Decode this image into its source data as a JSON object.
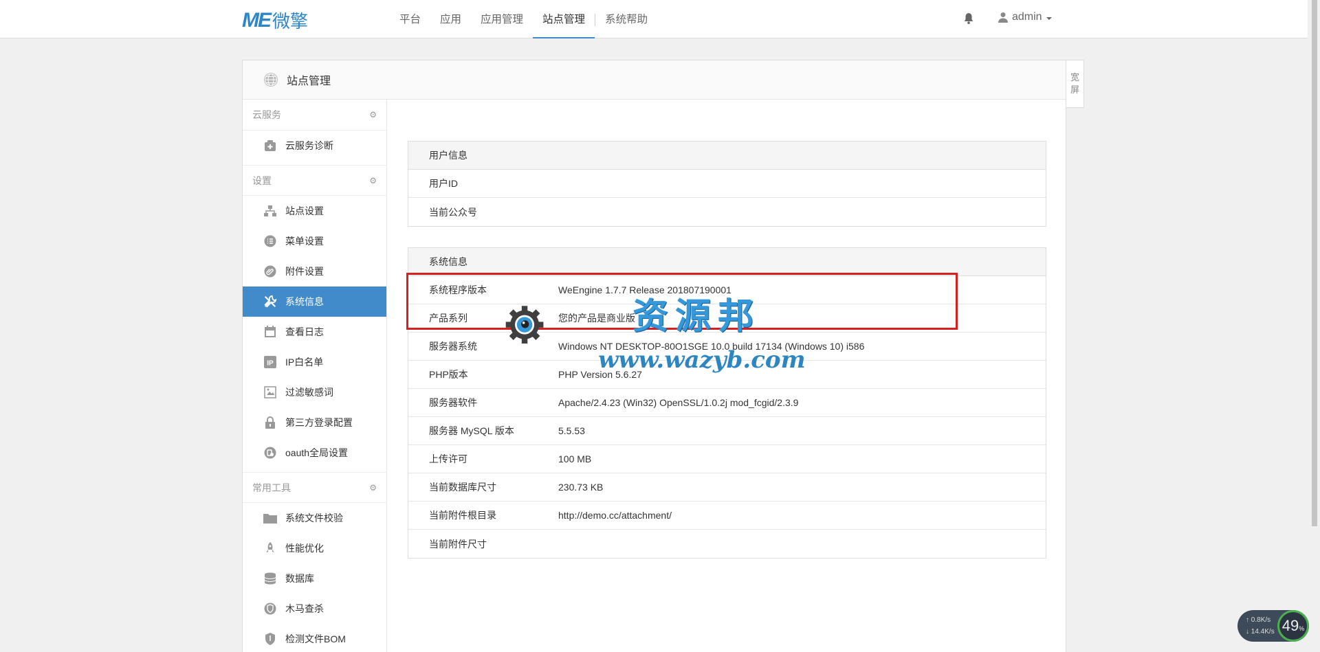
{
  "app": {
    "logo_mark": "ME",
    "logo_text": "微擎"
  },
  "nav": {
    "items": [
      "平台",
      "应用",
      "应用管理",
      "站点管理",
      "系统帮助"
    ],
    "active_index": 3
  },
  "user": {
    "name": "admin"
  },
  "panel": {
    "title": "站点管理",
    "wide_label": [
      "宽",
      "屏"
    ]
  },
  "sidebar": {
    "groups": [
      {
        "label": "云服务",
        "items": [
          {
            "label": "云服务诊断",
            "icon": "cloud-plus-icon"
          }
        ]
      },
      {
        "label": "设置",
        "items": [
          {
            "label": "站点设置",
            "icon": "sitemap-icon"
          },
          {
            "label": "菜单设置",
            "icon": "list-icon"
          },
          {
            "label": "附件设置",
            "icon": "paperclip-icon"
          },
          {
            "label": "系统信息",
            "icon": "wrench-icon",
            "active": true
          },
          {
            "label": "查看日志",
            "icon": "calendar-icon"
          },
          {
            "label": "IP白名单",
            "icon": "ip-icon"
          },
          {
            "label": "过滤敏感词",
            "icon": "filter-icon"
          },
          {
            "label": "第三方登录配置",
            "icon": "lock-icon"
          },
          {
            "label": "oauth全局设置",
            "icon": "oauth-icon"
          }
        ]
      },
      {
        "label": "常用工具",
        "items": [
          {
            "label": "系统文件校验",
            "icon": "folder-icon"
          },
          {
            "label": "性能优化",
            "icon": "rocket-icon"
          },
          {
            "label": "数据库",
            "icon": "database-icon"
          },
          {
            "label": "木马查杀",
            "icon": "shield-scan-icon"
          },
          {
            "label": "检测文件BOM",
            "icon": "shield-icon"
          }
        ]
      }
    ]
  },
  "user_info": {
    "header": "用户信息",
    "rows": [
      {
        "k": "用户ID",
        "v": ""
      },
      {
        "k": "当前公众号",
        "v": ""
      }
    ]
  },
  "system_info": {
    "header": "系统信息",
    "rows": [
      {
        "k": "系统程序版本",
        "v": "WeEngine 1.7.7 Release 201807190001"
      },
      {
        "k": "产品系列",
        "v": "您的产品是商业版"
      },
      {
        "k": "服务器系统",
        "v": "Windows NT DESKTOP-80O1SGE 10.0 build 17134 (Windows 10) i586"
      },
      {
        "k": "PHP版本",
        "v": "PHP Version 5.6.27"
      },
      {
        "k": "服务器软件",
        "v": "Apache/2.4.23 (Win32) OpenSSL/1.0.2j mod_fcgid/2.3.9"
      },
      {
        "k": "服务器 MySQL 版本",
        "v": "5.5.53"
      },
      {
        "k": "上传许可",
        "v": "100 MB"
      },
      {
        "k": "当前数据库尺寸",
        "v": "230.73 KB"
      },
      {
        "k": "当前附件根目录",
        "v": "http://demo.cc/attachment/"
      },
      {
        "k": "当前附件尺寸",
        "v": ""
      }
    ]
  },
  "watermark": {
    "text": "资源邦",
    "url": "www.wazyb.com"
  },
  "net_widget": {
    "up": "0.8",
    "down": "14.4",
    "unit": "K/s",
    "percent": "49",
    "percent_sign": "%"
  }
}
